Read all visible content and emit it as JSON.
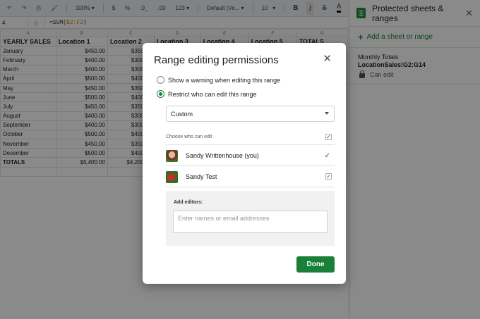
{
  "toolbar": {
    "undo_icon": "undo-icon",
    "redo_icon": "redo-icon",
    "print_icon": "print-icon",
    "paint_format_icon": "paint-format-icon",
    "zoom": "100%",
    "currency": "$",
    "percent": "%",
    "decrease_decimal": ".0_",
    "increase_decimal": ".00",
    "more_formats": "123",
    "font": "Default (Ve...",
    "font_size": "10",
    "bold": "B",
    "italic": "I",
    "strike": "S",
    "text_color": "A"
  },
  "formula_bar": {
    "cell_ref": "4",
    "fx": "fx",
    "formula_prefix": "=SUM(",
    "formula_ref": "B2:F2",
    "formula_suffix": ")"
  },
  "grid": {
    "columns": [
      "A",
      "B",
      "C",
      "D",
      "E",
      "F",
      "G"
    ],
    "header": [
      "YEARLY SALES",
      "Location 1",
      "Location 2",
      "Location 3",
      "Location 4",
      "Location 5",
      "TOTALS"
    ],
    "rows": [
      [
        "January",
        "$450.00",
        "$350.00"
      ],
      [
        "February",
        "$400.00",
        "$300.00"
      ],
      [
        "March",
        "$400.00",
        "$300.00"
      ],
      [
        "April",
        "$500.00",
        "$400.00"
      ],
      [
        "May",
        "$450.00",
        "$350.00"
      ],
      [
        "June",
        "$500.00",
        "$400.00"
      ],
      [
        "July",
        "$450.00",
        "$350.00"
      ],
      [
        "August",
        "$400.00",
        "$300.00"
      ],
      [
        "September",
        "$400.00",
        "$300.00"
      ],
      [
        "October",
        "$500.00",
        "$400.00"
      ],
      [
        "November",
        "$450.00",
        "$350.00"
      ],
      [
        "December",
        "$500.00",
        "$400.00"
      ]
    ],
    "totals": [
      "TOTALS",
      "$5,400.00",
      "$4,200.00"
    ]
  },
  "side_panel": {
    "title": "Protected sheets & ranges",
    "close_icon": "close-icon",
    "add_label": "Add a sheet or range",
    "range_name": "Monthly Totals",
    "range_ref": "LocationSales!G2:G14",
    "range_permission": "Can edit"
  },
  "dialog": {
    "title": "Range editing permissions",
    "radio_warning": "Show a warning when editing this range",
    "radio_restrict": "Restrict who can edit this range",
    "select_value": "Custom",
    "choose_label": "Choose who can edit",
    "people": [
      {
        "name": "Sandy Writtenhouse (you)"
      },
      {
        "name": "Sandy Test"
      }
    ],
    "add_editors_label": "Add editors:",
    "add_editors_placeholder": "Enter names or email addresses",
    "done_label": "Done",
    "accent_color": "#188038"
  }
}
